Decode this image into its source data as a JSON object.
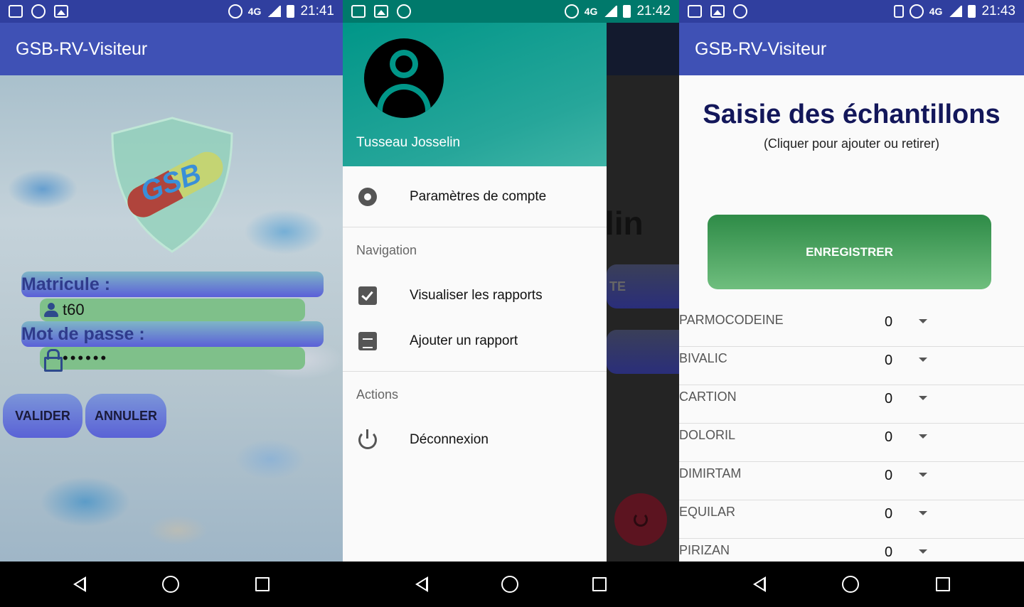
{
  "screens": [
    {
      "status": {
        "time": "21:41",
        "network": "4G"
      },
      "app_title": "GSB-RV-Visiteur",
      "logo_text": "GSB",
      "matricule_label": "Matricule :",
      "matricule_value": "t60",
      "password_label": "Mot de passe :",
      "password_value": "••••••",
      "valider_label": "VALIDER",
      "annuler_label": "ANNULER"
    },
    {
      "status": {
        "time": "21:42",
        "network": "4G"
      },
      "user_name": "Tusseau Josselin",
      "menu": {
        "account_settings": "Paramètres de compte",
        "section_navigation": "Navigation",
        "view_reports": "Visualiser les rapports",
        "add_report": "Ajouter un rapport",
        "section_actions": "Actions",
        "logout": "Déconnexion"
      },
      "behind": {
        "title_fragment": "lin",
        "button_fragment": "TE"
      }
    },
    {
      "status": {
        "time": "21:43",
        "network": "4G"
      },
      "app_title": "GSB-RV-Visiteur",
      "title": "Saisie des échantillons",
      "subtitle": "(Cliquer pour ajouter ou retirer)",
      "save_label": "ENREGISTRER",
      "samples": [
        {
          "name": "PARMOCODEINE",
          "qty": "0"
        },
        {
          "name": "BIVALIC",
          "qty": "0"
        },
        {
          "name": "CARTION",
          "qty": "0"
        },
        {
          "name": "DOLORIL",
          "qty": "0"
        },
        {
          "name": "DIMIRTAM",
          "qty": "0"
        },
        {
          "name": "EQUILAR",
          "qty": "0"
        },
        {
          "name": "PIRIZAN",
          "qty": "0"
        }
      ]
    }
  ],
  "colors": {
    "primary": "#3f51b5",
    "primary_dark": "#303f9f",
    "teal": "#009688",
    "green": "#2e8b47"
  }
}
